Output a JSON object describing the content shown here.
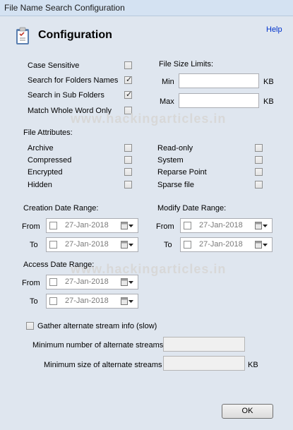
{
  "window": {
    "title": "File Name Search Configuration"
  },
  "header": {
    "title": "Configuration",
    "help": "Help"
  },
  "options": {
    "case_sensitive": {
      "label": "Case Sensitive",
      "checked": false
    },
    "search_folder_names": {
      "label": "Search for Folders Names",
      "checked": true
    },
    "search_sub_folders": {
      "label": "Search in Sub Folders",
      "checked": true
    },
    "match_whole_word": {
      "label": "Match Whole Word Only",
      "checked": false
    }
  },
  "file_size": {
    "title": "File Size Limits:",
    "min_label": "Min",
    "max_label": "Max",
    "unit": "KB"
  },
  "attributes": {
    "title": "File Attributes:",
    "left": [
      "Archive",
      "Compressed",
      "Encrypted",
      "Hidden"
    ],
    "right": [
      "Read-only",
      "System",
      "Reparse Point",
      "Sparse file"
    ]
  },
  "creation": {
    "title": "Creation Date Range:",
    "from_label": "From",
    "to_label": "To",
    "from": "27-Jan-2018",
    "to": "27-Jan-2018"
  },
  "modify": {
    "title": "Modify Date Range:",
    "from_label": "From",
    "to_label": "To",
    "from": "27-Jan-2018",
    "to": "27-Jan-2018"
  },
  "access": {
    "title": "Access Date Range:",
    "from_label": "From",
    "to_label": "To",
    "from": "27-Jan-2018",
    "to": "27-Jan-2018"
  },
  "streams": {
    "gather_label": "Gather alternate stream info (slow)",
    "min_number_label": "Minimum number of alternate streams",
    "min_size_label": "Minimum size of alternate streams",
    "unit": "KB"
  },
  "ok_label": "OK",
  "watermark": "www.hackingarticles.in"
}
